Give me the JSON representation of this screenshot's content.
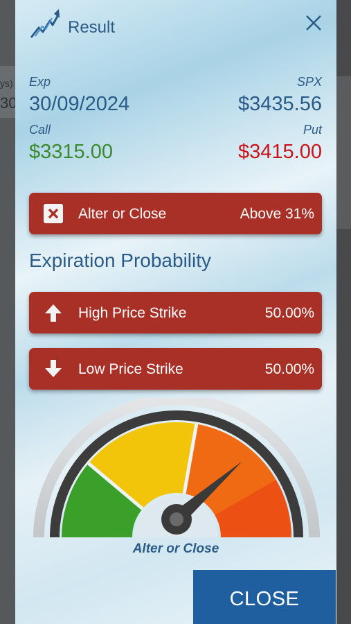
{
  "background": {
    "partial_text_top": "ys)",
    "partial_text_mid": "30"
  },
  "header": {
    "title": "Result",
    "logo_icon": "trend-arrow-logo-icon",
    "close_icon": "close-icon"
  },
  "summary": {
    "exp_label": "Exp",
    "exp_value": "30/09/2024",
    "spx_label": "SPX",
    "spx_value": "$3435.56",
    "call_label": "Call",
    "call_value": "$3315.00",
    "put_label": "Put",
    "put_value": "$3415.00"
  },
  "status": {
    "label": "Alter or Close",
    "value": "Above 31%",
    "icon": "x-box-icon"
  },
  "probability": {
    "title": "Expiration Probability",
    "high": {
      "label": "High Price Strike",
      "value": "50.00%",
      "icon": "arrow-up-icon"
    },
    "low": {
      "label": "Low Price Strike",
      "value": "50.00%",
      "icon": "arrow-down-icon"
    }
  },
  "gauge": {
    "label": "Alter or Close",
    "needle_level": 0.77,
    "colors": {
      "green": "#3aa02a",
      "yellow": "#f2c40a",
      "orange": "#f06a14",
      "red": "#ea3a10"
    }
  },
  "footer": {
    "close_label": "CLOSE"
  },
  "colors": {
    "primary_blue": "#2b5b87",
    "button_red": "#a93026",
    "call_green": "#3a8a2c",
    "put_red": "#c8141a",
    "close_button": "#1f5fa0"
  }
}
